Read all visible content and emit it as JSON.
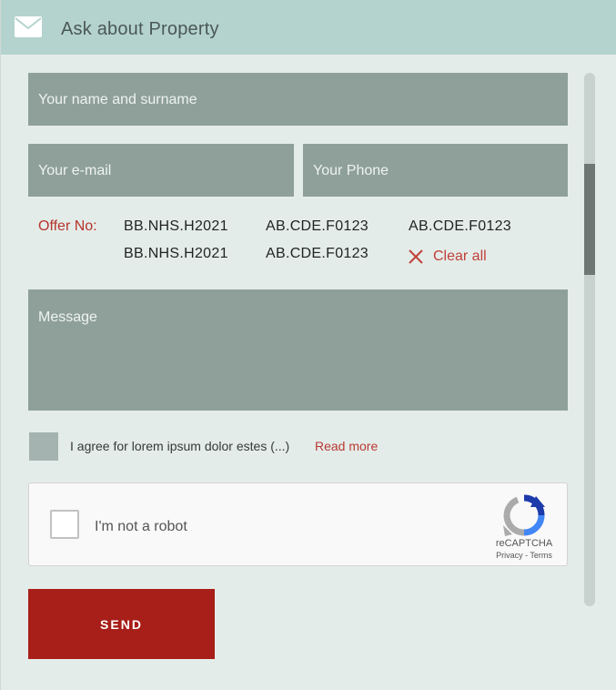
{
  "header": {
    "title": "Ask about Property",
    "icon": "envelope-icon"
  },
  "form": {
    "name_placeholder": "Your name and surname",
    "email_placeholder": "Your e-mail",
    "phone_placeholder": "Your Phone",
    "message_placeholder": "Message"
  },
  "offers": {
    "label": "Offer No:",
    "codes": [
      "BB.NHS.H2021",
      "AB.CDE.F0123",
      "AB.CDE.F0123",
      "BB.NHS.H2021",
      "AB.CDE.F0123"
    ],
    "clear_label": "Clear all"
  },
  "agreement": {
    "text": "I agree for lorem ipsum dolor estes (...)",
    "read_more": "Read more"
  },
  "captcha": {
    "label": "I'm not a robot",
    "brand": "reCAPTCHA",
    "terms": "Privacy - Terms"
  },
  "send_label": "SEND",
  "colors": {
    "header_bg": "#b5d3ce",
    "field_bg": "#8fa09b",
    "accent_red": "#a81e18",
    "link_red": "#c0413a"
  }
}
